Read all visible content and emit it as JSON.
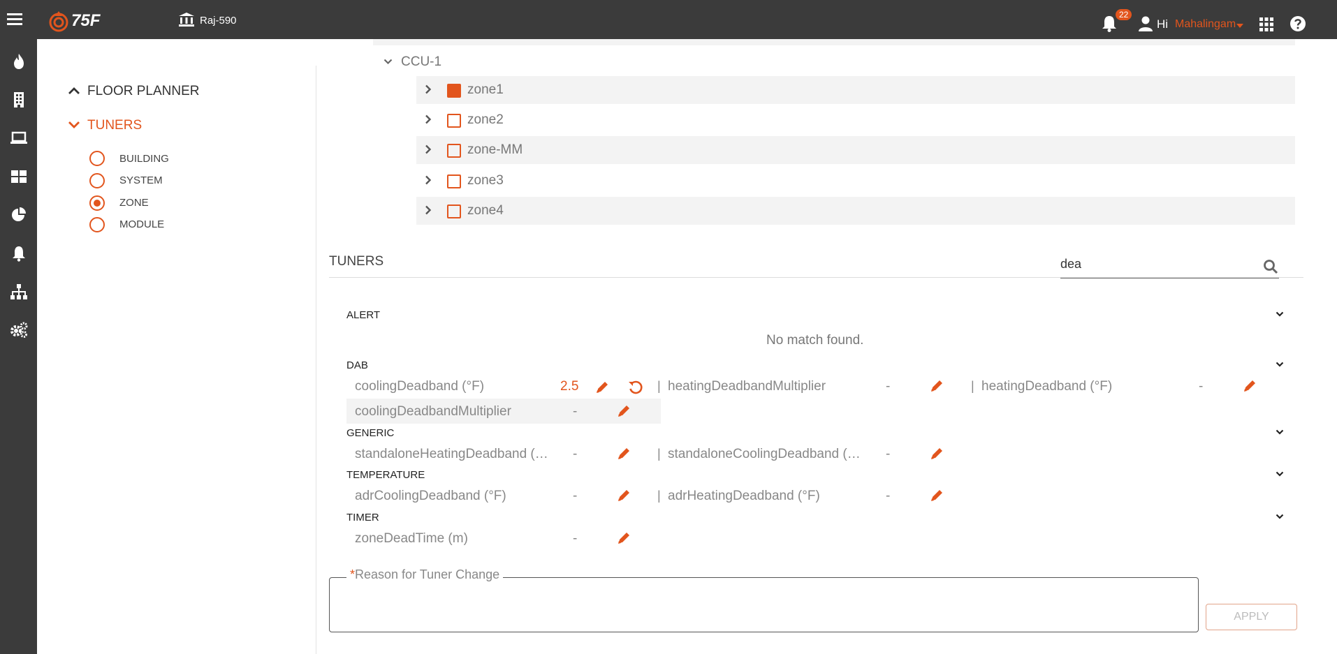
{
  "header": {
    "logo_text": "75F",
    "site_name": "Raj-590",
    "notifications_count": "22",
    "greeting": "Hi",
    "user_name": "Mahalingam"
  },
  "left_nav_icons": [
    "flame-icon",
    "building-icon",
    "laptop-icon",
    "dashboard-icon",
    "pie-chart-icon",
    "bell-icon",
    "hierarchy-icon",
    "settings-icon"
  ],
  "sidebar": {
    "floor_planner": "FLOOR PLANNER",
    "tuners": "TUNERS",
    "options": [
      {
        "label": "BUILDING",
        "selected": false
      },
      {
        "label": "SYSTEM",
        "selected": false
      },
      {
        "label": "ZONE",
        "selected": true
      },
      {
        "label": "MODULE",
        "selected": false
      }
    ]
  },
  "tree": {
    "ccu": "CCU-1",
    "zones": [
      {
        "name": "zone1",
        "checked": true
      },
      {
        "name": "zone2",
        "checked": false
      },
      {
        "name": "zone-MM",
        "checked": false
      },
      {
        "name": "zone3",
        "checked": false
      },
      {
        "name": "zone4",
        "checked": false
      }
    ]
  },
  "tuners_panel": {
    "title": "TUNERS",
    "search_value": "dea",
    "categories": {
      "alert": {
        "label": "ALERT",
        "empty_message": "No match found."
      },
      "dab": {
        "label": "DAB",
        "items": [
          {
            "name": "coolingDeadband (°F)",
            "value": "2.5"
          },
          {
            "name": "heatingDeadbandMultiplier",
            "value": "-"
          },
          {
            "name": "heatingDeadband (°F)",
            "value": "-"
          },
          {
            "name": "coolingDeadbandMultiplier",
            "value": "-"
          }
        ]
      },
      "generic": {
        "label": "GENERIC",
        "items": [
          {
            "name": "standaloneHeatingDeadband (…",
            "value": "-"
          },
          {
            "name": "standaloneCoolingDeadband (…",
            "value": "-"
          }
        ]
      },
      "temperature": {
        "label": "TEMPERATURE",
        "items": [
          {
            "name": "adrCoolingDeadband (°F)",
            "value": "-"
          },
          {
            "name": "adrHeatingDeadband (°F)",
            "value": "-"
          }
        ]
      },
      "timer": {
        "label": "TIMER",
        "items": [
          {
            "name": "zoneDeadTime (m)",
            "value": "-"
          }
        ]
      }
    },
    "separator": "|",
    "reason_required_mark": "*",
    "reason_label": "Reason for Tuner Change",
    "apply_label": "APPLY"
  },
  "colors": {
    "accent": "#e2551d",
    "nav_bg": "#3b3b3b"
  }
}
